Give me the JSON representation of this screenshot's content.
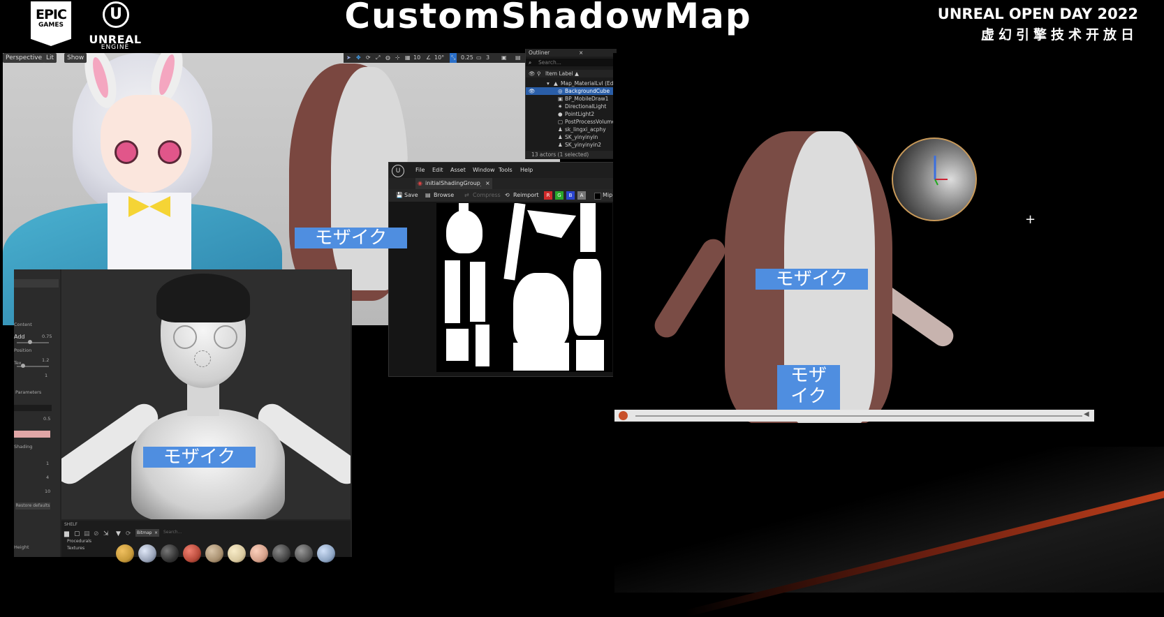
{
  "header": {
    "epic_logo_line1": "EPIC",
    "epic_logo_line2": "GAMES",
    "ue_logo_line1": "UNREAL",
    "ue_logo_line2": "ENGINE",
    "title": "CustomShadowMap",
    "event_en": "UNREAL OPEN DAY 2022",
    "event_zh": "虚幻引擎技术开放日"
  },
  "viewport": {
    "perspective": "Perspective",
    "lit": "Lit",
    "show": "Show",
    "snap_values": [
      "10",
      "10°",
      "0.25",
      "3"
    ]
  },
  "outliner": {
    "title": "Outliner",
    "search_placeholder": "Search...",
    "column": "Item Label ▲",
    "items": [
      "Map_MaterialLvl (Editor)",
      "BackgroundCube",
      "BP_MobileDraw1",
      "DirectionalLight",
      "PointLight2",
      "PostProcessVolume",
      "sk_lingxi_acphy",
      "SK_yinyinyin",
      "SK_yinyinyin2"
    ],
    "status": "13 actors (1 selected)"
  },
  "texture_editor": {
    "menu": [
      "File",
      "Edit",
      "Asset",
      "Window",
      "Tools",
      "Help"
    ],
    "tab": "initialShadingGroup_Ba...",
    "toolbar": [
      "Save",
      "Browse",
      "Compress",
      "Reimport"
    ],
    "channels": [
      "R",
      "G",
      "B",
      "A"
    ],
    "channel_colors": [
      "#d02a2a",
      "#2aa82a",
      "#2a45d0",
      "#777777"
    ],
    "extra": "Mip"
  },
  "material_editor": {
    "side_values": [
      "0.75",
      "1.2",
      "1",
      "0.5",
      "1",
      "4",
      "10"
    ],
    "side_labels": [
      "Content",
      "Add",
      "Position",
      "Tex",
      "Parameters",
      "Shading",
      "Height"
    ],
    "restore_button": "Restore defaults",
    "shelf_title": "SHELF",
    "shelf_search_tag": "Bitmap",
    "shelf_search_placeholder": "Search...",
    "shelf_folders": [
      "Procedurals",
      "Textures"
    ],
    "ball_colors": [
      "#c79a3a",
      "#9aa4b8",
      "#333333",
      "#b84a3a",
      "#a89070",
      "#d9c9a0",
      "#d4a08a",
      "#444444",
      "#555555",
      "#8fa6c4"
    ]
  },
  "mosaic_label": "モザイク",
  "mosaic_label_split": [
    "モザ",
    "イク"
  ]
}
